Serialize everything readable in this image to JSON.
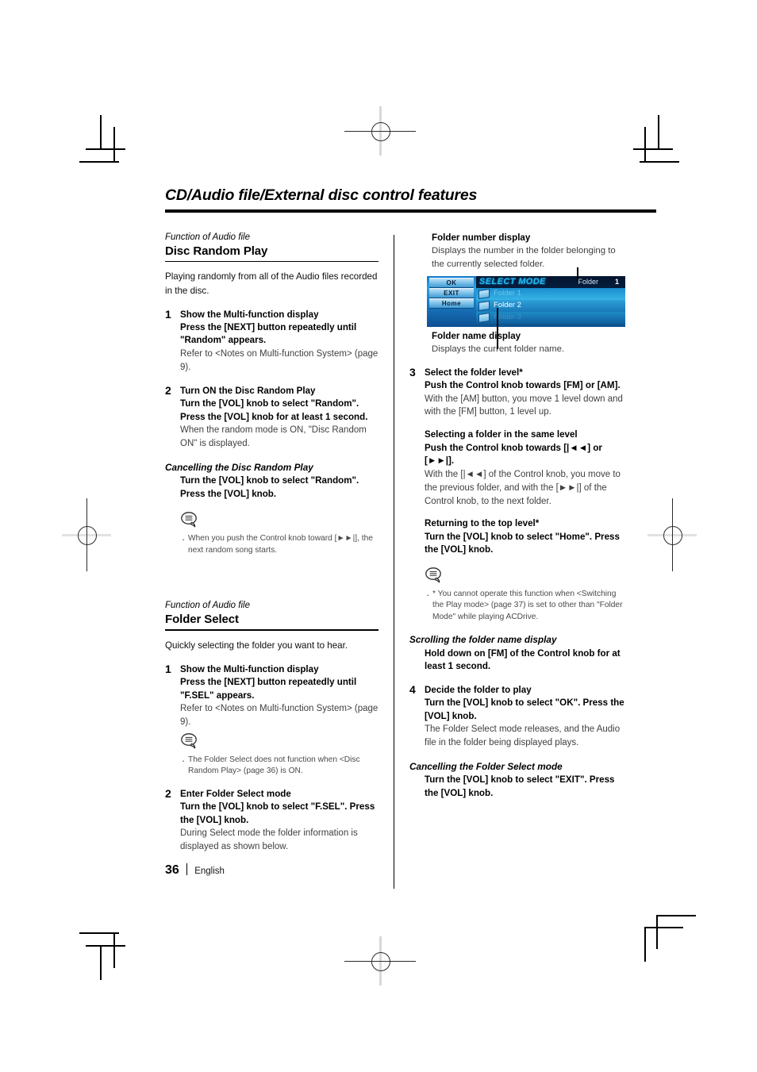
{
  "page": {
    "chapter_title": "CD/Audio file/External disc control features",
    "page_number": "36",
    "language": "English"
  },
  "left_column": {
    "section1": {
      "function_label": "Function of Audio file",
      "title": "Disc Random Play",
      "intro": "Playing randomly from all of the Audio files recorded in the disc.",
      "steps": [
        {
          "num": "1",
          "heading_line1": "Show the Multi-function display",
          "heading_line2": "Press the [NEXT] button repeatedly until \"Random\" appears.",
          "body": "Refer to <Notes on Multi-function System> (page 9)."
        },
        {
          "num": "2",
          "heading_line1": "Turn ON the Disc Random Play",
          "heading_line2": "Turn the [VOL] knob to select \"Random\". Press the [VOL] knob for at least 1 second.",
          "body": "When the random mode is ON, \"Disc Random ON\" is displayed."
        }
      ],
      "cancel": {
        "heading": "Cancelling the Disc Random Play",
        "instruction": "Turn the [VOL] knob to select \"Random\". Press the [VOL] knob."
      },
      "note": "When you push the Control knob toward [►►|], the next random song starts."
    },
    "section2": {
      "function_label": "Function of Audio file",
      "title": "Folder Select",
      "intro": "Quickly selecting the folder you want to hear.",
      "step1": {
        "num": "1",
        "heading_line1": "Show the Multi-function display",
        "heading_line2": "Press the [NEXT] button repeatedly until \"F.SEL\" appears.",
        "body": "Refer to <Notes on Multi-function System> (page 9).",
        "note": "The Folder Select does not function when <Disc Random Play> (page 36) is ON."
      },
      "step2": {
        "num": "2",
        "heading_line1": "Enter Folder Select mode",
        "heading_line2": "Turn the [VOL] knob to select \"F.SEL\". Press the [VOL] knob.",
        "body": "During Select mode the folder information is displayed as shown below."
      }
    }
  },
  "right_column": {
    "callout_top": {
      "heading": "Folder number display",
      "body": "Displays the number in the folder belonging to the currently selected folder."
    },
    "lcd": {
      "buttons": [
        "OK",
        "EXIT",
        "Home"
      ],
      "mode_title": "SELECT MODE",
      "folder_label": "Folder",
      "folder_number": "1",
      "rows": [
        "Folder 1",
        "Folder 2",
        "Folder 3"
      ]
    },
    "callout_bottom": {
      "heading": "Folder name display",
      "body": "Displays the current folder name."
    },
    "step3": {
      "num": "3",
      "heading_line1": "Select the folder level*",
      "heading_line2": "Push the Control knob towards [FM] or [AM].",
      "body": "With the [AM] button, you move 1 level down and with the [FM] button, 1 level up."
    },
    "same_level": {
      "heading_line1": "Selecting a folder in the same level",
      "heading_line2": "Push the Control knob towards [|◄◄] or [►►|].",
      "body": "With the [|◄◄] of the Control knob, you move to the previous folder, and with the [►►|] of the Control knob, to the next folder."
    },
    "top_level": {
      "heading_line1": "Returning to the top level*",
      "heading_line2": "Turn the [VOL] knob to select \"Home\". Press the [VOL] knob.",
      "note": "* You cannot operate this function when <Switching the Play mode> (page 37) is set to other than \"Folder Mode\" while playing ACDrive."
    },
    "scrolling": {
      "heading": "Scrolling the folder name display",
      "instruction": "Hold down on [FM] of the Control knob for at least 1 second."
    },
    "step4": {
      "num": "4",
      "heading_line1": "Decide the folder to play",
      "heading_line2": "Turn the [VOL] knob to select \"OK\". Press the [VOL] knob.",
      "body": "The Folder Select mode releases, and the Audio file in the folder being displayed plays."
    },
    "cancel_mode": {
      "heading": "Cancelling the Folder Select mode",
      "instruction": "Turn the [VOL] knob to select \"EXIT\". Press the [VOL] knob."
    }
  },
  "icons": {
    "note_bubble": "speech-bubble-note-icon"
  }
}
